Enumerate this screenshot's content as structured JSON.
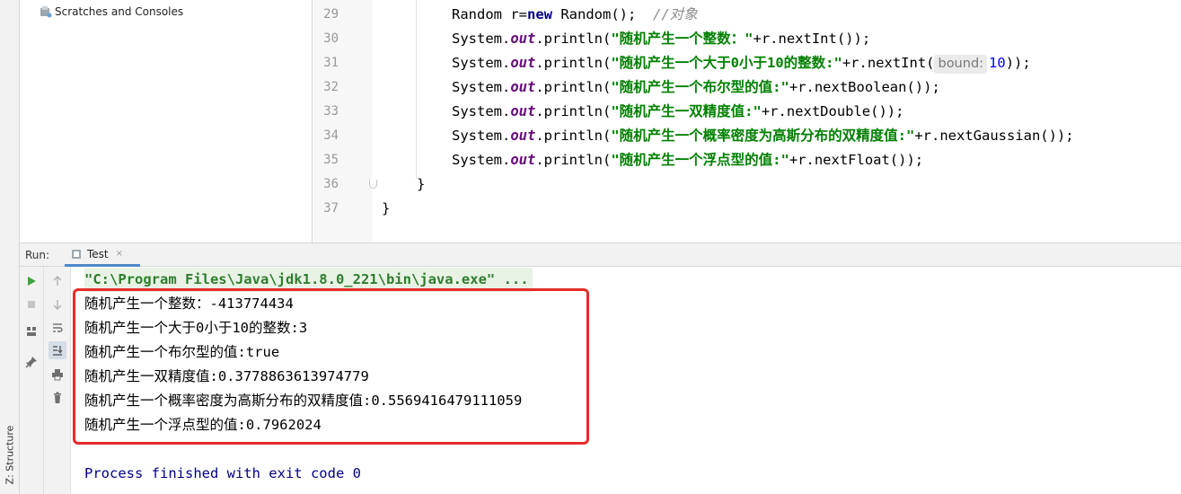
{
  "sidebar": {
    "structure_label": "Z: Structure"
  },
  "project": {
    "scratches_label": "Scratches and Consoles"
  },
  "editor": {
    "line_numbers": [
      "29",
      "30",
      "31",
      "32",
      "33",
      "34",
      "35",
      "36",
      "37"
    ],
    "lines": {
      "l29": {
        "t1": "Random r=",
        "kw": "new",
        "t2": " Random();  ",
        "comment": "//对象"
      },
      "l30": {
        "sys": "System.",
        "out": "out",
        "call": ".println(",
        "str": "\"随机产生一个整数：\"",
        "rest": "+r.nextInt());"
      },
      "l31": {
        "sys": "System.",
        "out": "out",
        "call": ".println(",
        "str": "\"随机产生一个大于0小于10的整数:\"",
        "rest": "+r.nextInt(",
        "hint": "bound:",
        "num": "10",
        "end": "));"
      },
      "l32": {
        "sys": "System.",
        "out": "out",
        "call": ".println(",
        "str": "\"随机产生一个布尔型的值:\"",
        "rest": "+r.nextBoolean());"
      },
      "l33": {
        "sys": "System.",
        "out": "out",
        "call": ".println(",
        "str": "\"随机产生一双精度值:\"",
        "rest": "+r.nextDouble());"
      },
      "l34": {
        "sys": "System.",
        "out": "out",
        "call": ".println(",
        "str": "\"随机产生一个概率密度为高斯分布的双精度值:\"",
        "rest": "+r.nextGaussian());"
      },
      "l35": {
        "sys": "System.",
        "out": "out",
        "call": ".println(",
        "str": "\"随机产生一个浮点型的值:\"",
        "rest": "+r.nextFloat());"
      },
      "l36": "}",
      "l37": "}"
    }
  },
  "run": {
    "label": "Run:",
    "tab_label": "Test",
    "tab_close": "×",
    "command": "\"C:\\Program Files\\Java\\jdk1.8.0_221\\bin\\java.exe\" ...",
    "output": [
      "随机产生一个整数：-413774434",
      "随机产生一个大于0小于10的整数:3",
      "随机产生一个布尔型的值:true",
      "随机产生一双精度值:0.3778863613974779",
      "随机产生一个概率密度为高斯分布的双精度值:0.5569416479111059",
      "随机产生一个浮点型的值:0.7962024"
    ],
    "exit_message": "Process finished with exit code 0"
  },
  "colors": {
    "highlight_box": "#e82a2a",
    "run_green": "#3fa33f",
    "tab_underline": "#4d89c9"
  }
}
